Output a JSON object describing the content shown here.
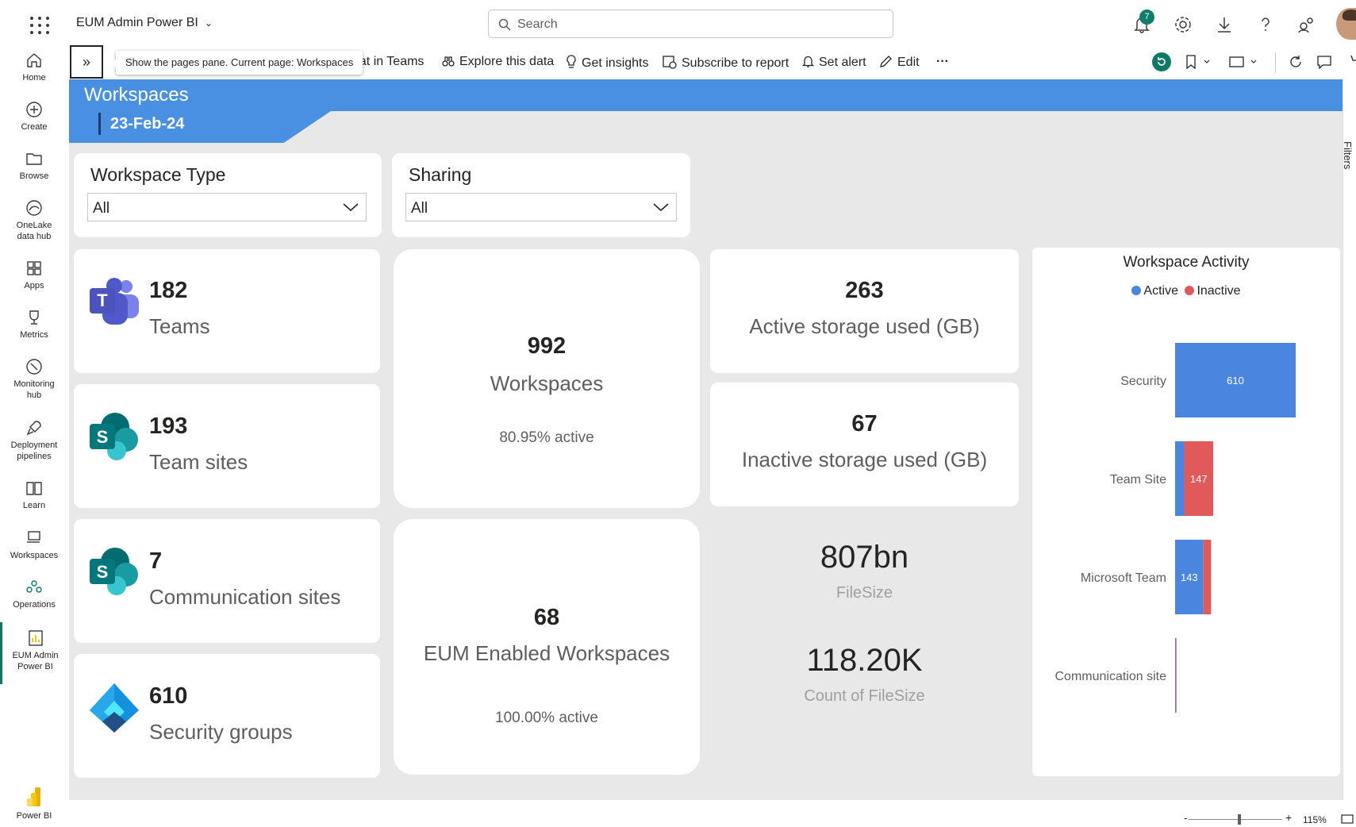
{
  "app": {
    "title": "EUM Admin Power BI",
    "search_placeholder": "Search",
    "notification_count": "7"
  },
  "rail": [
    {
      "label": "Home",
      "icon": "home-icon"
    },
    {
      "label": "Create",
      "icon": "create-icon"
    },
    {
      "label": "Browse",
      "icon": "folder-icon"
    },
    {
      "label": "OneLake data hub",
      "icon": "onelake-icon"
    },
    {
      "label": "Apps",
      "icon": "apps-icon"
    },
    {
      "label": "Metrics",
      "icon": "trophy-icon"
    },
    {
      "label": "Monitoring hub",
      "icon": "monitor-icon"
    },
    {
      "label": "Deployment pipelines",
      "icon": "rocket-icon"
    },
    {
      "label": "Learn",
      "icon": "book-icon"
    },
    {
      "label": "Workspaces",
      "icon": "workspaces-icon"
    },
    {
      "label": "Operations",
      "icon": "operations-icon"
    },
    {
      "label": "EUM Admin Power BI",
      "icon": "report-icon"
    },
    {
      "label": "Power BI",
      "icon": "powerbi-logo-icon"
    }
  ],
  "toolbar": {
    "tooltip": "Show the pages pane. Current page: Workspaces",
    "chat": "hat in Teams",
    "explore": "Explore this data",
    "insights": "Get insights",
    "subscribe": "Subscribe to report",
    "alert": "Set alert",
    "edit": "Edit",
    "more": "···"
  },
  "report": {
    "title": "Workspaces",
    "date": "23-Feb-24",
    "filters_label": "Filters",
    "slicers": [
      {
        "title": "Workspace Type",
        "value": "All"
      },
      {
        "title": "Sharing",
        "value": "All"
      }
    ],
    "kpis": [
      {
        "value": "182",
        "label": "Teams",
        "icon": "teams-icon"
      },
      {
        "value": "193",
        "label": "Team sites",
        "icon": "sharepoint-icon"
      },
      {
        "value": "7",
        "label": "Communication sites",
        "icon": "sharepoint-icon"
      },
      {
        "value": "610",
        "label": "Security groups",
        "icon": "entra-icon"
      }
    ],
    "workspaces": {
      "value": "992",
      "label": "Workspaces",
      "sub": "80.95% active"
    },
    "eum": {
      "value": "68",
      "label": "EUM Enabled Workspaces",
      "sub": "100.00% active"
    },
    "active_storage": {
      "value": "263",
      "label": "Active storage used (GB)"
    },
    "inactive_storage": {
      "value": "67",
      "label": "Inactive storage used (GB)"
    },
    "filesize": {
      "value": "807bn",
      "label": "FileSize"
    },
    "count_filesize": {
      "value": "118.20K",
      "label": "Count of FileSize"
    }
  },
  "colors": {
    "active": "#4a86e0",
    "inactive": "#e05a5a",
    "header": "#4a90e2"
  },
  "chart_data": {
    "type": "bar",
    "title": "Workspace Activity",
    "legend": [
      "Active",
      "Inactive"
    ],
    "legend_position": "top-center",
    "categories": [
      "Security",
      "Team Site",
      "Microsoft Team",
      "Communication site"
    ],
    "series": [
      {
        "name": "Active",
        "values": [
          610,
          46,
          143,
          3
        ]
      },
      {
        "name": "Inactive",
        "values": [
          0,
          147,
          39,
          4
        ]
      }
    ],
    "data_labels": [
      "610",
      "147",
      "143",
      ""
    ],
    "orientation": "horizontal",
    "stacked": true
  },
  "status": {
    "zoom": "115%"
  }
}
